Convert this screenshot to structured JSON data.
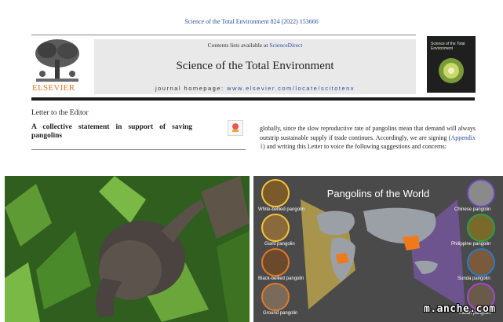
{
  "header": {
    "citation": "Science of the Total Environment 824 (2022) 153666",
    "contents_prefix": "Contents lists available at ",
    "contents_link": "ScienceDirect",
    "journal_title": "Science of the Total Environment",
    "homepage_prefix": "journal homepage: ",
    "homepage_url": "www.elsevier.com/locate/scitotenv",
    "publisher": "ELSEVIER",
    "cover_title": "Science of the Total Environment"
  },
  "article": {
    "section": "Letter to the Editor",
    "title": "A collective statement in support of saving pangolins",
    "body_part1": "globally, since the slow reproductive rate of pangolins mean that demand will always outstrip sustainable supply if trade continues. Accordingly, we are signing (",
    "body_link": "Appendix 1",
    "body_part2": ") and writing this Letter to voice the following suggestions and concerns:"
  },
  "infographic": {
    "title": "Pangolins of the World",
    "left_species": [
      "White-bellied pangolin",
      "Giant pangolin",
      "Black-bellied pangolin",
      "Ground pangolin"
    ],
    "right_species": [
      "Chinese pangolin",
      "Philippine pangolin",
      "Sunda pangolin",
      "Indian pangolin"
    ]
  },
  "watermark": "m.anche.com",
  "colors": {
    "link": "#2a4f9e",
    "elsevier_orange": "#e87722",
    "infographic_bg": "#4a4a4a"
  }
}
